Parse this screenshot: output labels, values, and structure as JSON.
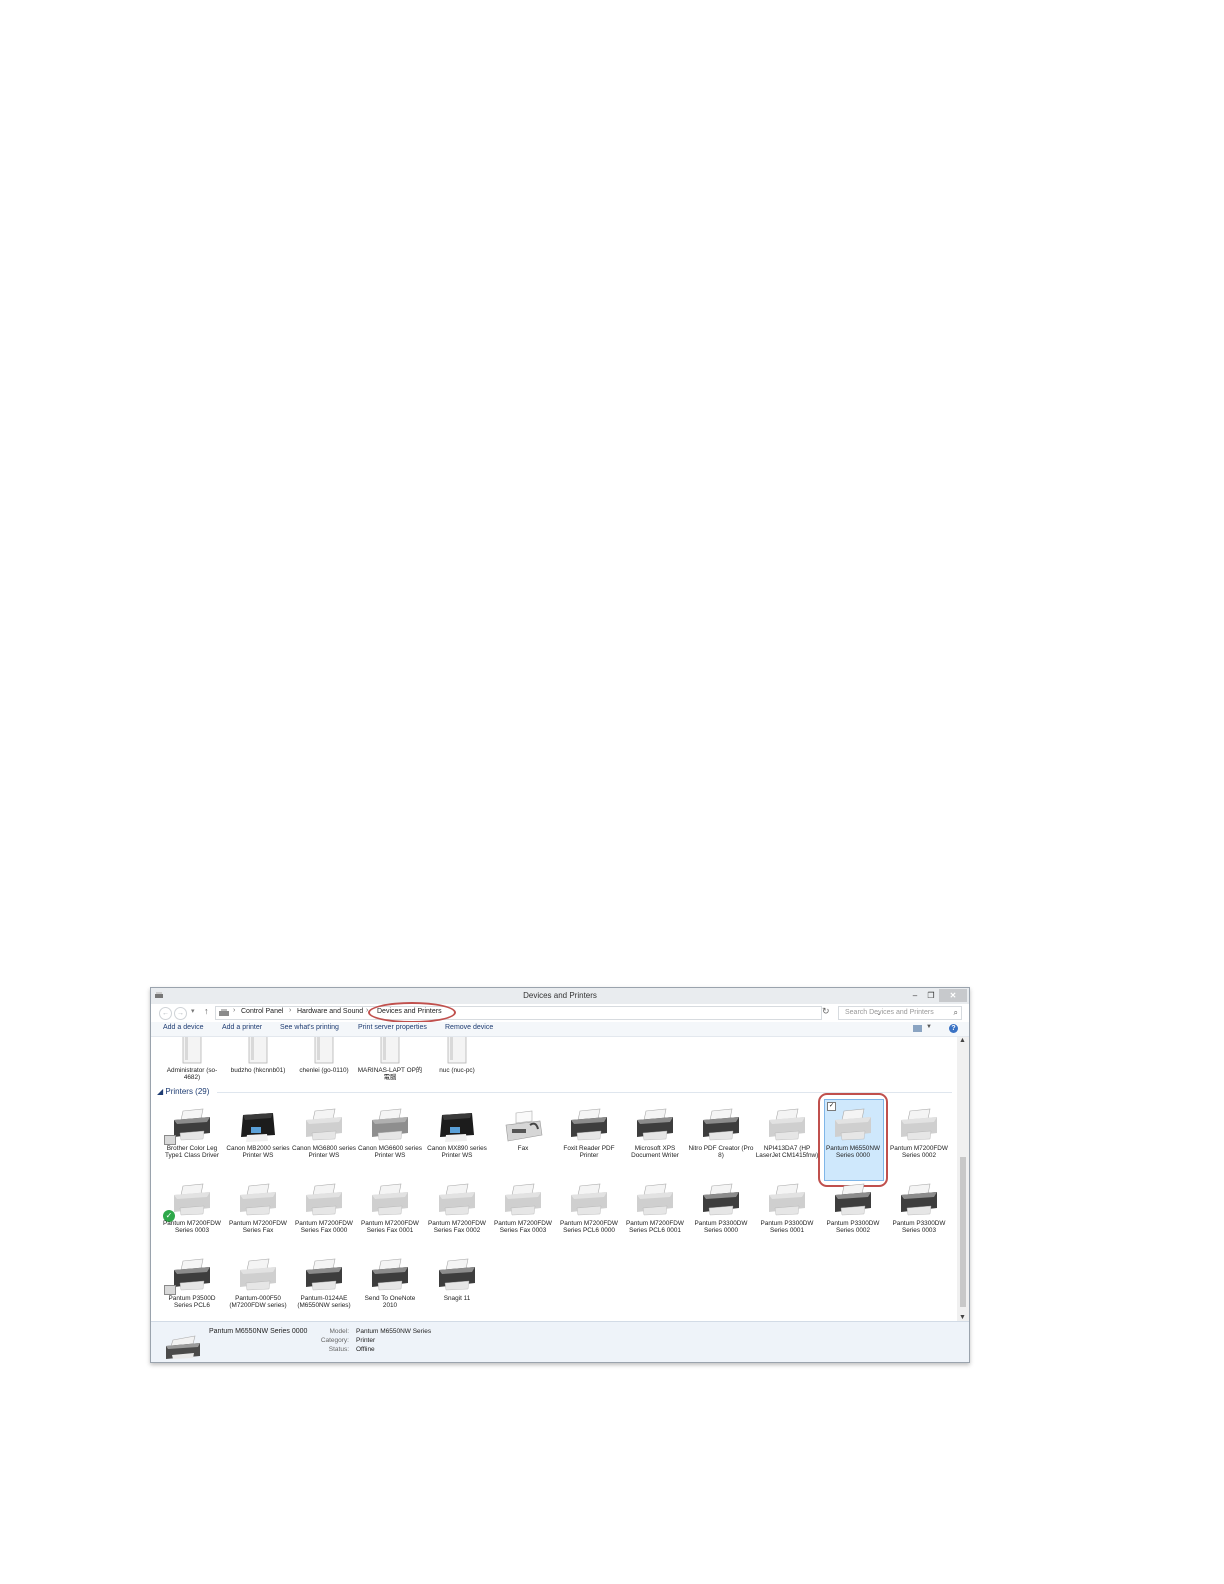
{
  "window": {
    "title": "Devices and Printers",
    "min": "–",
    "max": "❐",
    "close": "✕"
  },
  "nav": {
    "back": "←",
    "forward": "→",
    "dropdown": "▾",
    "up": "↑"
  },
  "breadcrumbs": {
    "sep": "›",
    "items": [
      "Control Panel",
      "Hardware and Sound",
      "Devices and Printers"
    ]
  },
  "search": {
    "placeholder": "Search Devices and Printers"
  },
  "toolbar": {
    "items": [
      "Add a device",
      "Add a printer",
      "See what's printing",
      "Print server properties",
      "Remove device"
    ]
  },
  "computers": [
    {
      "label": "Administrator (so-4682)"
    },
    {
      "label": "budzho (hkcnnb01)"
    },
    {
      "label": "chenlei (go-0110)"
    },
    {
      "label": "MARINAS-LAPT OP的電腦"
    },
    {
      "label": "nuc (nuc-pc)"
    }
  ],
  "printers_header": "Printers (29)",
  "printers": [
    {
      "label": "Brother Color Leg Type1 Class Driver",
      "style": "dark"
    },
    {
      "label": "Canon MB2000 series Printer WS",
      "style": "black"
    },
    {
      "label": "Canon MG6800 series Printer WS",
      "style": "light"
    },
    {
      "label": "Canon MG6600 series Printer WS",
      "style": "grey"
    },
    {
      "label": "Canon MX890 series Printer WS",
      "style": "black"
    },
    {
      "label": "Fax",
      "style": "fax"
    },
    {
      "label": "Foxit Reader PDF Printer",
      "style": "dark"
    },
    {
      "label": "Microsoft XPS Document Writer",
      "style": "dark"
    },
    {
      "label": "Nitro PDF Creator (Pro 8)",
      "style": "dark"
    },
    {
      "label": "NPI413DA7 (HP LaserJet CM1415fnw)",
      "style": "light"
    },
    {
      "label": "Pantum M6550NW Series 0000",
      "style": "light"
    },
    {
      "label": "Pantum M7200FDW Series 0002",
      "style": "light"
    },
    {
      "label": "Pantum M7200FDW Series 0003",
      "style": "light"
    },
    {
      "label": "Pantum M7200FDW Series Fax",
      "style": "light"
    },
    {
      "label": "Pantum M7200FDW Series Fax 0000",
      "style": "light"
    },
    {
      "label": "Pantum M7200FDW Series Fax 0001",
      "style": "light"
    },
    {
      "label": "Pantum M7200FDW Series Fax 0002",
      "style": "light"
    },
    {
      "label": "Pantum M7200FDW Series Fax 0003",
      "style": "light"
    },
    {
      "label": "Pantum M7200FDW Series PCL6 0000",
      "style": "light"
    },
    {
      "label": "Pantum M7200FDW Series PCL6 0001",
      "style": "light"
    },
    {
      "label": "Pantum P3300DW Series 0000",
      "style": "dark"
    },
    {
      "label": "Pantum P3300DW Series 0001",
      "style": "light"
    },
    {
      "label": "Pantum P3300DW Series 0002",
      "style": "dark"
    },
    {
      "label": "Pantum P3300DW Series 0003",
      "style": "dark"
    },
    {
      "label": "Pantum P3500D Series PCL6",
      "style": "dark"
    },
    {
      "label": "Pantum-000F50 (M7200FDW series)",
      "style": "light"
    },
    {
      "label": "Pantum-0124AE (M6550NW series)",
      "style": "dark"
    },
    {
      "label": "Send To OneNote 2010",
      "style": "dark"
    },
    {
      "label": "Snagit 11",
      "style": "dark"
    }
  ],
  "selected_printer": "Pantum M6550NW Series 0000",
  "details": {
    "name": "Pantum M6550NW Series 0000",
    "rows": [
      {
        "key": "Model:",
        "value": "Pantum M6550NW Series"
      },
      {
        "key": "Category:",
        "value": "Printer"
      },
      {
        "key": "Status:",
        "value": "Offline"
      }
    ]
  },
  "colors": {
    "selection": "#cfe8fc",
    "highlight_ring": "#c0504d",
    "link_text": "#1e3c72"
  }
}
